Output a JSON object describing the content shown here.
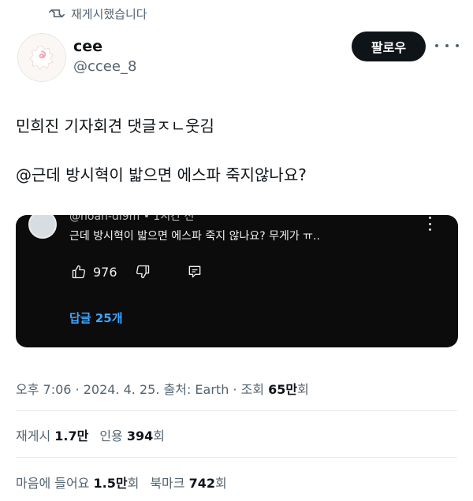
{
  "repost_banner": {
    "icon": "repost-icon",
    "text": "재게시했습니다"
  },
  "author": {
    "name": "cee",
    "handle": "@ccee_8",
    "avatar_icon": "narutomaki-avatar"
  },
  "follow_button": {
    "label": "팔로우"
  },
  "tweet": {
    "line1": "민희진 기자회견 댓글ㅈㄴ웃김",
    "line2": "@근데 방시혁이 밟으면 에스파 죽지않나요?"
  },
  "media": {
    "commenter_cut_text": "@noah-di9m • 1시간 전",
    "comment_text": "근데 방시혁이 밟으면 에스파 죽지 않나요? 무게가 ㅠ..",
    "like_count": "976",
    "replies_label": "답글 25개",
    "colors": {
      "background": "#0c0c0c",
      "link": "#3ea6ff"
    }
  },
  "meta": {
    "time": "오후 7:06",
    "dot1": " · ",
    "date": "2024. 4. 25.",
    "source": " 출처: Earth",
    "dot2": " · ",
    "views_label": "조회 ",
    "views_value": "65만",
    "views_unit": "회"
  },
  "stats": {
    "reposts_label": "재게시 ",
    "reposts_value": "1.7만",
    "quotes_label": "인용 ",
    "quotes_value": "394",
    "quotes_unit": "회",
    "likes_label": "마음에 들어요 ",
    "likes_value": "1.5만",
    "likes_unit": "회",
    "bookmarks_label": "북마크 ",
    "bookmarks_value": "742",
    "bookmarks_unit": "회"
  }
}
